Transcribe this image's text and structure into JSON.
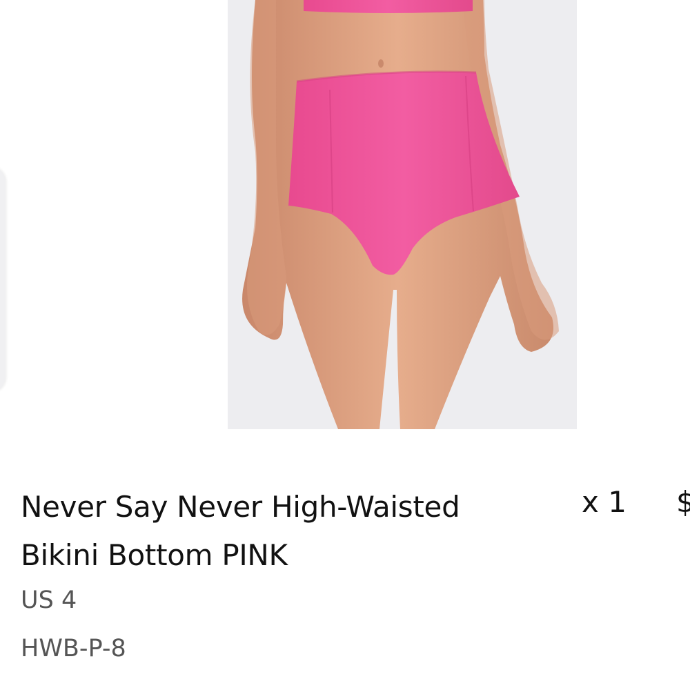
{
  "cart_item": {
    "name_line1": "Never Say Never High-Waisted",
    "name_line2": "Bikini Bottom PINK",
    "quantity": "x 1",
    "price_fragment": "$",
    "variant": "US 4",
    "sku": "HWB-P-8"
  },
  "image": {
    "icon": "product-photo",
    "garment_color": "#f0559b",
    "skin_color": "#e2a583",
    "background_color": "#ededf0"
  }
}
